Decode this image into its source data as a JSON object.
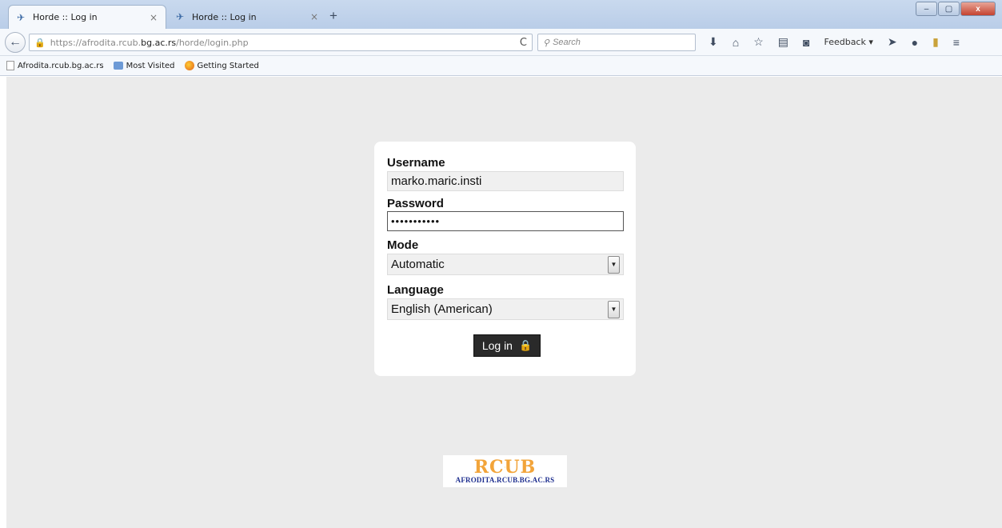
{
  "browser": {
    "tabs": [
      {
        "title": "Horde :: Log in",
        "close": "×"
      },
      {
        "title": "Horde :: Log in",
        "close": "×"
      }
    ],
    "new_tab": "+",
    "url": {
      "prefix": "https://afrodita.rcub.",
      "domain": "bg.ac.rs",
      "path": "/horde/login.php"
    },
    "reload": "C",
    "search_placeholder": "Search",
    "feedback": "Feedback ▾",
    "bookmarks": [
      {
        "label": "Afrodita.rcub.bg.ac.rs",
        "icon": "page-icon"
      },
      {
        "label": "Most Visited",
        "icon": "folder-icon"
      },
      {
        "label": "Getting Started",
        "icon": "firefox-icon"
      }
    ],
    "window_buttons": {
      "minimize": "–",
      "maximize": "▢",
      "close": "x"
    }
  },
  "login": {
    "username_label": "Username",
    "username_value": "marko.maric.insti",
    "password_label": "Password",
    "password_value": "•••••••••••",
    "mode_label": "Mode",
    "mode_value": "Automatic",
    "language_label": "Language",
    "language_value": "English (American)",
    "button_label": "Log in"
  },
  "logo": {
    "main": "RCUB",
    "sub": "AFRODITA.RCUB.BG.AC.RS"
  },
  "colors": {
    "chrome": "#c9d9ee",
    "page_bg": "#ebebeb",
    "button": "#2a2a2a",
    "logo_orange": "#f2a43a",
    "logo_blue": "#1e2f8f"
  }
}
